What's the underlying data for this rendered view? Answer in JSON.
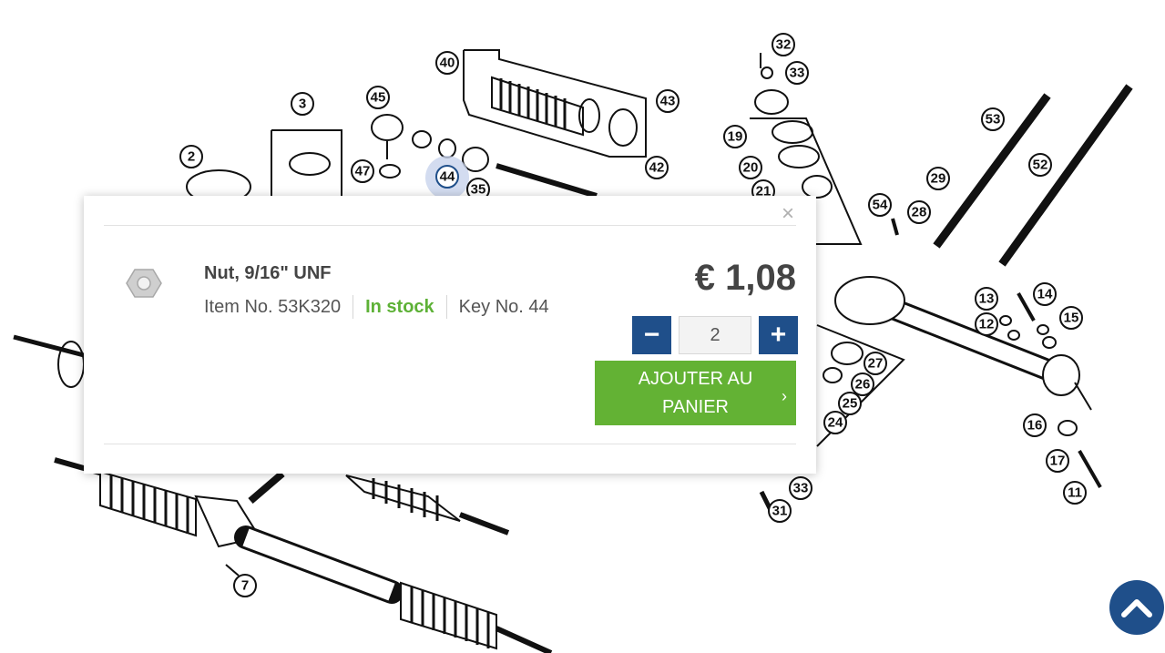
{
  "diagram": {
    "callouts": [
      "40",
      "43",
      "42",
      "45",
      "3",
      "2",
      "47",
      "44",
      "35",
      "32",
      "33",
      "19",
      "20",
      "21",
      "54",
      "53",
      "52",
      "29",
      "28",
      "13",
      "14",
      "12",
      "15",
      "27",
      "26",
      "25",
      "24",
      "16",
      "17",
      "11",
      "33",
      "31",
      "7"
    ]
  },
  "popup": {
    "close_label": "×",
    "product_name": "Nut, 9/16\" UNF",
    "item_no": "Item No. 53K320",
    "stock_status": "In stock",
    "key_no": "Key No. 44",
    "price": "€ 1,08",
    "quantity": "2",
    "minus_label": "−",
    "plus_label": "+",
    "add_to_cart_label": "AJOUTER AU PANIER",
    "add_to_cart_chevron": "›"
  },
  "colors": {
    "brand_blue": "#1f4f8a",
    "cart_green": "#63b234",
    "stock_green": "#5db136"
  },
  "icons": [
    "hex-nut-icon",
    "minus-icon",
    "plus-icon",
    "chevron-right-icon",
    "chevron-up-icon",
    "close-icon"
  ]
}
